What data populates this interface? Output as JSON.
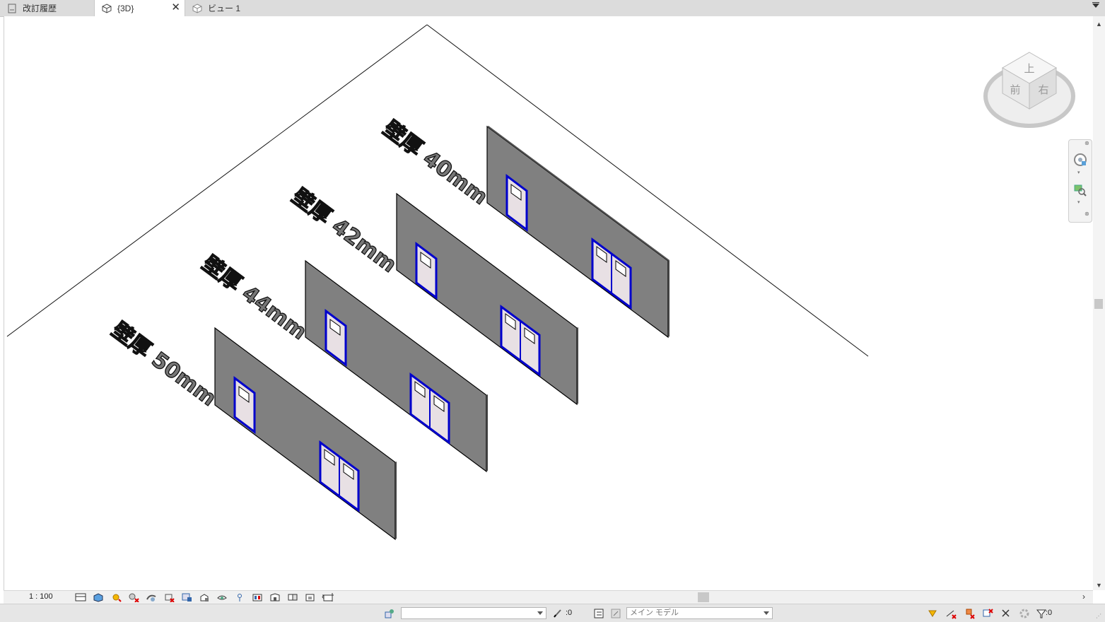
{
  "tabs": [
    {
      "label": "改訂履歴",
      "icon": "sheet-icon",
      "active": false
    },
    {
      "label": "{3D}",
      "icon": "3d-view-icon",
      "active": true
    },
    {
      "label": "ビュー 1",
      "icon": "3d-view-icon",
      "active": false
    }
  ],
  "model_labels": [
    "壁厚 50mm",
    "壁厚 44mm",
    "壁厚 42mm",
    "壁厚 40mm"
  ],
  "viewcube": {
    "top": "上",
    "front": "前",
    "right": "右"
  },
  "view_control_bar": {
    "scale": "1 : 100",
    "icons": [
      "detail-level-icon",
      "visual-style-icon",
      "sun-path-icon",
      "shadows-icon",
      "render-icon",
      "crop-view-icon",
      "show-crop-region-icon",
      "lock-3d-view-icon",
      "temporary-hide-icon",
      "reveal-hidden-icon",
      "analytical-model-icon",
      "highlight-displacement-icon",
      "constraints-icon",
      "worksharing-icon",
      "model-properties-icon"
    ]
  },
  "statusbar": {
    "workset_value": "",
    "editable_count": ":0",
    "design_option": "メイン モデル",
    "filter_count": ":0"
  },
  "colors": {
    "wall": "#808080",
    "door_frame": "#0000cc",
    "door_panel": "#e8e0e4",
    "outline": "#000000"
  }
}
